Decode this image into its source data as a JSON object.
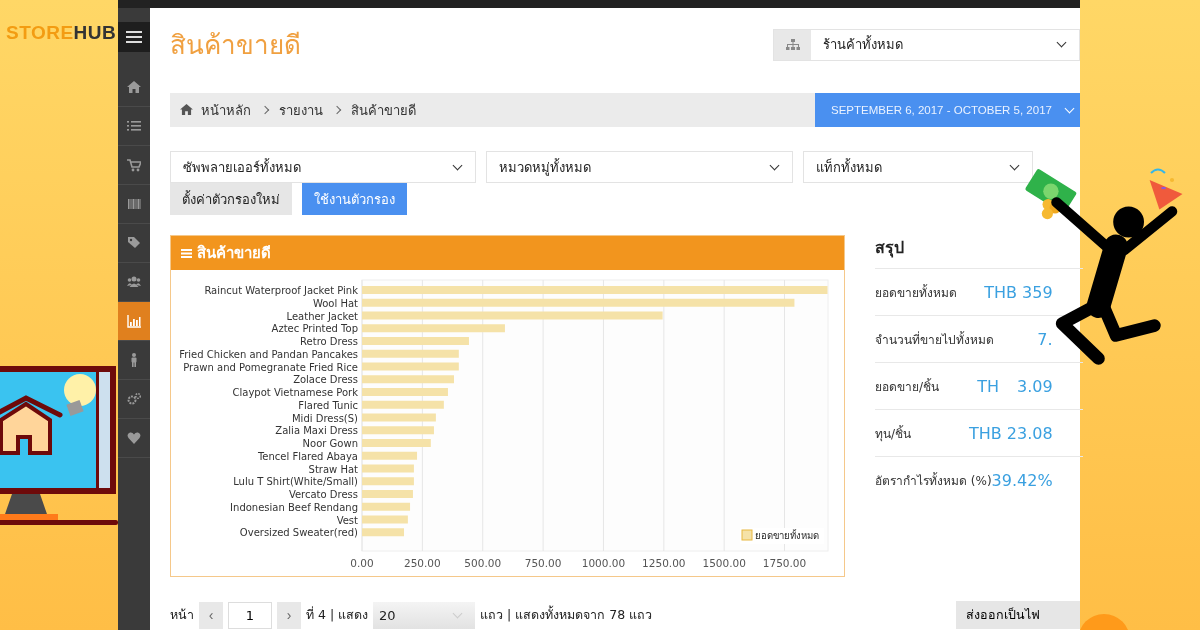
{
  "logo": {
    "part1": "STORE",
    "part2": "HUB"
  },
  "sidebar": {
    "items": [
      {
        "selected": false
      },
      {
        "selected": false
      },
      {
        "selected": false
      },
      {
        "selected": false
      },
      {
        "selected": false
      },
      {
        "selected": false
      },
      {
        "selected": true
      },
      {
        "selected": false
      },
      {
        "selected": false
      },
      {
        "selected": false
      }
    ]
  },
  "page_title": "สินค้าขายดี",
  "store_select": {
    "value": "ร้านค้าทั้งหมด"
  },
  "breadcrumb": [
    "หน้าหลัก",
    "รายงาน",
    "สินค้าขายดี"
  ],
  "date_range": "SEPTEMBER 6, 2017 - OCTOBER 5, 2017",
  "filters": [
    {
      "value": "ซัพพลายเออร์ทั้งหมด"
    },
    {
      "value": "หมวดหมู่ทั้งหมด"
    },
    {
      "value": "แท็กทั้งหมด"
    }
  ],
  "buttons": [
    {
      "label": "ตั้งค่าตัวกรองใหม่",
      "kind": "secondary"
    },
    {
      "label": "ใช้งานตัวกรอง",
      "kind": "primary"
    }
  ],
  "panel": {
    "title": "สินค้าขายดี",
    "chart_data": {
      "type": "bar",
      "orientation": "horizontal",
      "categories": [
        "Raincut Waterproof Jacket Pink",
        "Wool Hat",
        "Leather Jacket",
        "Aztec Printed Top",
        "Retro Dress",
        "Fried Chicken and Pandan Pancakes",
        "Prawn and Pomegranate Fried Rice",
        "Zolace Dress",
        "Claypot Vietnamese Pork",
        "Flared Tunic",
        "Midi Dress(S)",
        "Zalia Maxi Dress",
        "Noor Gown",
        "Tencel Flared Abaya",
        "Straw Hat",
        "Lulu T Shirt(White/Small)",
        "Vercato Dress",
        "Indonesian Beef Rendang",
        "Vest",
        "Oversized Sweater(red)"
      ],
      "series": [
        {
          "name": "ยอดขายทั้งหมด",
          "color": "#f5e2a8",
          "values": [
            1928,
            1791,
            1245,
            592,
            443,
            401,
            401,
            381,
            356,
            339,
            306,
            298,
            285,
            228,
            215,
            215,
            211,
            199,
            190,
            174
          ]
        }
      ],
      "xlim": [
        0,
        1930
      ],
      "grid": true,
      "xticks": [
        {
          "value": 0,
          "label": "0.00"
        },
        {
          "value": 250,
          "label": "250.00"
        },
        {
          "value": 500,
          "label": "500.00"
        },
        {
          "value": 750,
          "label": "750.00"
        },
        {
          "value": 1000,
          "label": "1000.00"
        },
        {
          "value": 1250,
          "label": "1250.00"
        },
        {
          "value": 1500,
          "label": "1500.00"
        },
        {
          "value": 1750,
          "label": "1750.00"
        }
      ]
    }
  },
  "summary": {
    "title": "สรุป",
    "rows": [
      {
        "label": "ยอดขายทั้งหมด",
        "value": [
          "THB 359"
        ]
      },
      {
        "label": "จำนวนที่ขายไปทั้งหมด",
        "value": [
          "7."
        ]
      },
      {
        "label": "ยอดขาย/ชิ้น",
        "value": [
          "TH",
          "3.09"
        ]
      },
      {
        "label": "ทุน/ชิ้น",
        "value": [
          "THB 23.08"
        ]
      },
      {
        "label": "อัตรากำไรทั้งหมด (%)",
        "value": [
          "39.42%"
        ]
      }
    ]
  },
  "pagination": {
    "page_label": "หน้า",
    "prev": "‹",
    "page": "1",
    "next": "›",
    "of_text": "ที่ 4 | แสดง",
    "per_page": "20",
    "total_text": "แถว | แสดงทั้งหมดจาก 78 แถว",
    "export": "ส่งออกเป็นไฟ"
  }
}
